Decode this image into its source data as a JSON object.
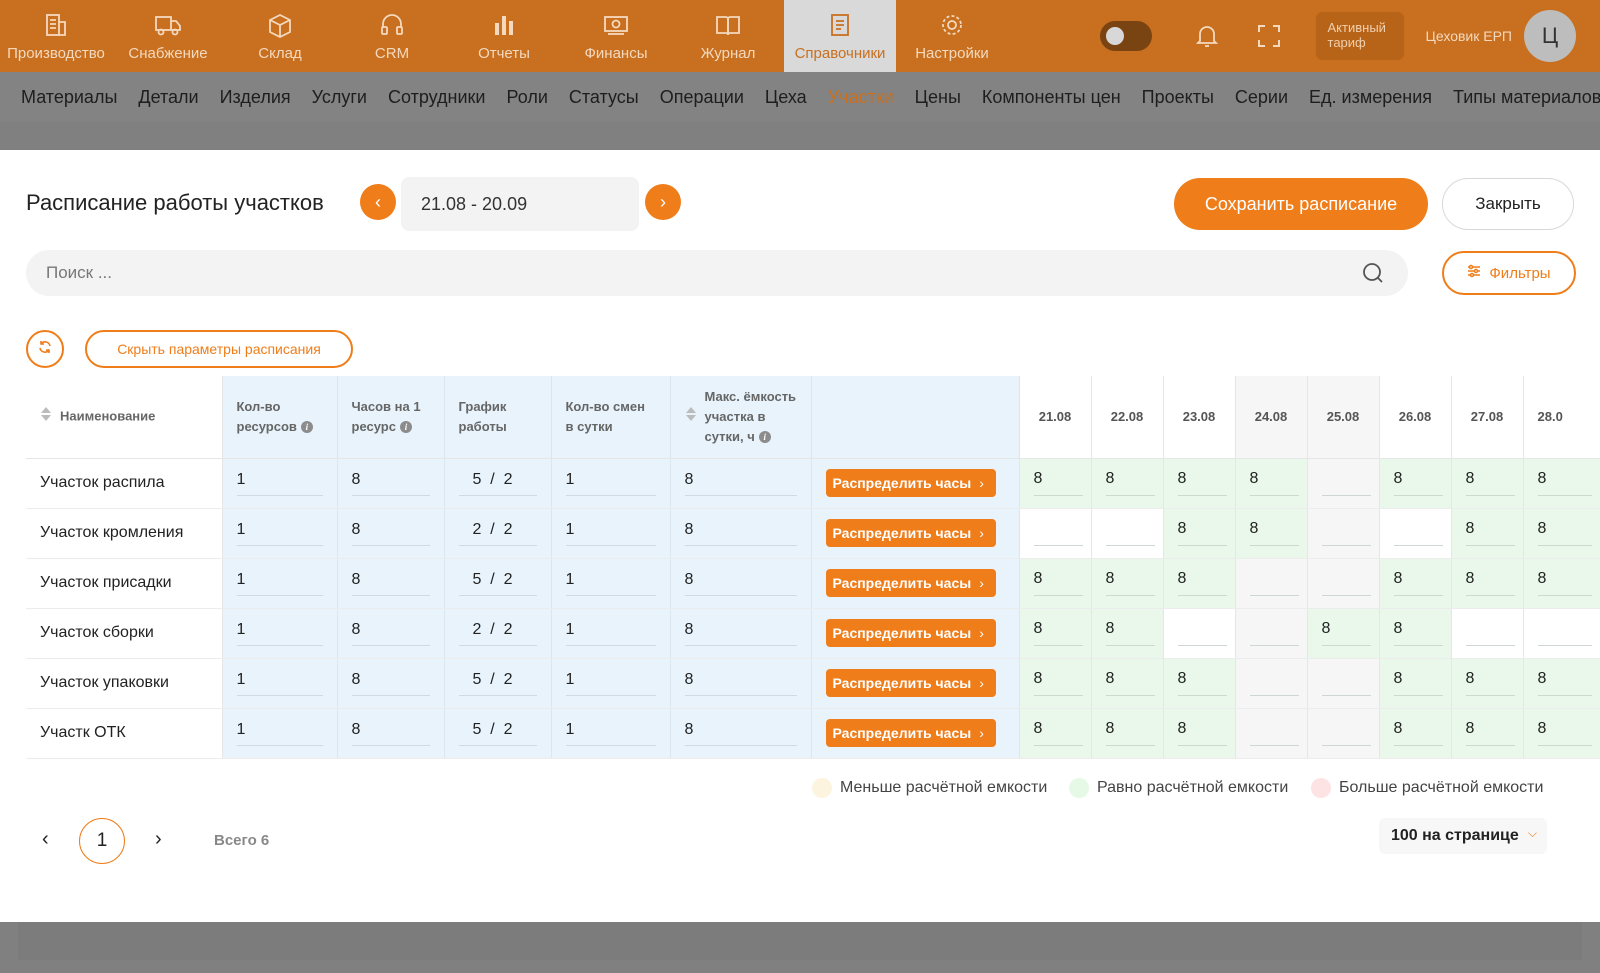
{
  "topnav": {
    "items": [
      {
        "label": "Производство",
        "icon": "factory-icon"
      },
      {
        "label": "Снабжение",
        "icon": "truck-icon"
      },
      {
        "label": "Склад",
        "icon": "box-icon"
      },
      {
        "label": "CRM",
        "icon": "headset-icon"
      },
      {
        "label": "Отчеты",
        "icon": "bar-chart-icon"
      },
      {
        "label": "Финансы",
        "icon": "money-icon"
      },
      {
        "label": "Журнал",
        "icon": "book-icon"
      },
      {
        "label": "Справочники",
        "icon": "document-icon",
        "active": true
      },
      {
        "label": "Настройки",
        "icon": "gear-icon"
      }
    ],
    "tariff_line1": "Активный",
    "tariff_line2": "тариф",
    "user_name": "Цеховик ЕРП",
    "avatar_letter": "Ц"
  },
  "subnav": {
    "items": [
      "Материалы",
      "Детали",
      "Изделия",
      "Услуги",
      "Сотрудники",
      "Роли",
      "Статусы",
      "Операции",
      "Цеха",
      "Участки",
      "Цены",
      "Компоненты цен",
      "Проекты",
      "Серии",
      "Ед. измерения",
      "Типы материалов"
    ],
    "active_index": 9
  },
  "modal": {
    "title": "Расписание работы участков",
    "date_range": "21.08 - 20.09",
    "prev_arrow": "‹",
    "next_arrow": "›",
    "save_label": "Сохранить расписание",
    "close_label": "Закрыть",
    "search_placeholder": "Поиск ...",
    "filters_label": "Фильтры",
    "hide_params_label": "Скрыть параметры расписания"
  },
  "table": {
    "headers": {
      "name": "Наименование",
      "resources_1": "Кол-во",
      "resources_2": "ресурсов",
      "hours_1": "Часов на 1",
      "hours_2": "ресурс",
      "schedule_1": "График",
      "schedule_2": "работы",
      "shifts_1": "Кол-во смен",
      "shifts_2": "в сутки",
      "capacity_1": "Макс. ёмкость",
      "capacity_2": "участка в",
      "capacity_3": "сутки, ч",
      "info": "i"
    },
    "dates": [
      "21.08",
      "22.08",
      "23.08",
      "24.08",
      "25.08",
      "26.08",
      "27.08",
      "28.0"
    ],
    "weekend_cols": [
      3,
      4
    ],
    "distribute_label": "Распределить часы",
    "distribute_chevron": "›",
    "rows": [
      {
        "name": "Участок распила",
        "resources": "1",
        "hours": "8",
        "sched_a": "5",
        "sched_sep": "/",
        "sched_b": "2",
        "shifts": "1",
        "capacity": "8",
        "days": [
          "8",
          "8",
          "8",
          "8",
          "",
          "8",
          "8",
          "8"
        ]
      },
      {
        "name": "Участок кромления",
        "resources": "1",
        "hours": "8",
        "sched_a": "2",
        "sched_sep": "/",
        "sched_b": "2",
        "shifts": "1",
        "capacity": "8",
        "days": [
          "",
          "",
          "8",
          "8",
          "",
          "",
          "8",
          "8"
        ]
      },
      {
        "name": "Участок присадки",
        "resources": "1",
        "hours": "8",
        "sched_a": "5",
        "sched_sep": "/",
        "sched_b": "2",
        "shifts": "1",
        "capacity": "8",
        "days": [
          "8",
          "8",
          "8",
          "",
          "",
          "8",
          "8",
          "8"
        ]
      },
      {
        "name": "Участок сборки",
        "resources": "1",
        "hours": "8",
        "sched_a": "2",
        "sched_sep": "/",
        "sched_b": "2",
        "shifts": "1",
        "capacity": "8",
        "days": [
          "8",
          "8",
          "",
          "",
          "8",
          "8",
          "",
          ""
        ]
      },
      {
        "name": "Участок упаковки",
        "resources": "1",
        "hours": "8",
        "sched_a": "5",
        "sched_sep": "/",
        "sched_b": "2",
        "shifts": "1",
        "capacity": "8",
        "days": [
          "8",
          "8",
          "8",
          "",
          "",
          "8",
          "8",
          "8"
        ]
      },
      {
        "name": "Участк ОТК",
        "resources": "1",
        "hours": "8",
        "sched_a": "5",
        "sched_sep": "/",
        "sched_b": "2",
        "shifts": "1",
        "capacity": "8",
        "days": [
          "8",
          "8",
          "8",
          "",
          "",
          "8",
          "8",
          "8"
        ]
      }
    ]
  },
  "legend": {
    "less": "Меньше расчётной емкости",
    "equal": "Равно расчётной емкости",
    "more": "Больше расчётной емкости",
    "colors": {
      "less": "#fdf4df",
      "equal": "#e6f8e6",
      "more": "#fde3e3"
    }
  },
  "pagination": {
    "prev": "‹",
    "current": "1",
    "next": "›",
    "total": "Всего 6",
    "per_page": "100 на странице",
    "per_page_chevron": "⌵"
  },
  "colors": {
    "accent": "#ef7d1a",
    "topbar": "#c8701f",
    "param_bg": "#e8f3fb",
    "equal_bg": "#e9f8ea"
  }
}
